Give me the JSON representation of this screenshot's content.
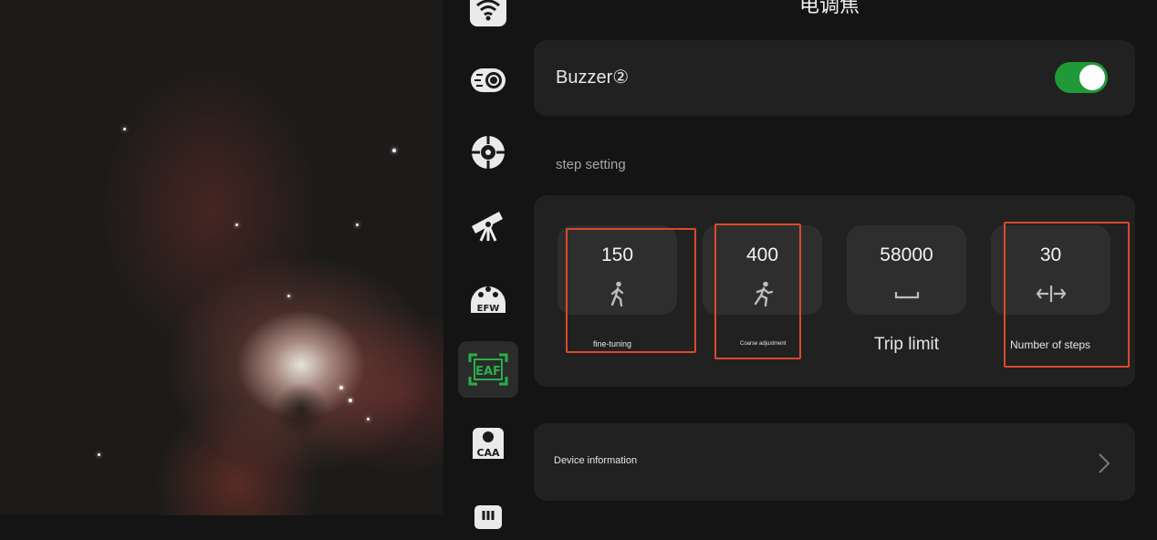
{
  "header": {
    "title": "电调焦"
  },
  "buzzer": {
    "label": "Buzzer②",
    "enabled": true
  },
  "step_setting": {
    "section_label": "step setting",
    "items": [
      {
        "value": "150",
        "caption": "fine-tuning",
        "icon": "walk-icon"
      },
      {
        "value": "400",
        "caption": "Coarse adjustment",
        "icon": "run-icon"
      },
      {
        "value": "58000",
        "caption": "Trip limit",
        "icon": "space-bar-icon"
      },
      {
        "value": "30",
        "caption": "Number of steps",
        "icon": "arrows-left-right-icon"
      }
    ]
  },
  "device_information": {
    "label": "Device information"
  },
  "sidebar": {
    "items": [
      {
        "name": "wifi",
        "icon": "wifi-icon"
      },
      {
        "name": "camera",
        "icon": "camera-icon"
      },
      {
        "name": "guide",
        "icon": "crosshair-icon"
      },
      {
        "name": "mount",
        "icon": "telescope-icon"
      },
      {
        "name": "filter-wheel",
        "icon": "efw-icon",
        "text": "EFW"
      },
      {
        "name": "focuser",
        "icon": "eaf-icon",
        "text": "EAF",
        "active": true
      },
      {
        "name": "rotator",
        "icon": "caa-icon",
        "text": "CAA"
      },
      {
        "name": "more",
        "icon": "device-icon"
      }
    ]
  },
  "colors": {
    "accent_green": "#1f9a36",
    "highlight_red": "#d94a2b",
    "panel": "#212121",
    "card": "#2e2e2e"
  }
}
